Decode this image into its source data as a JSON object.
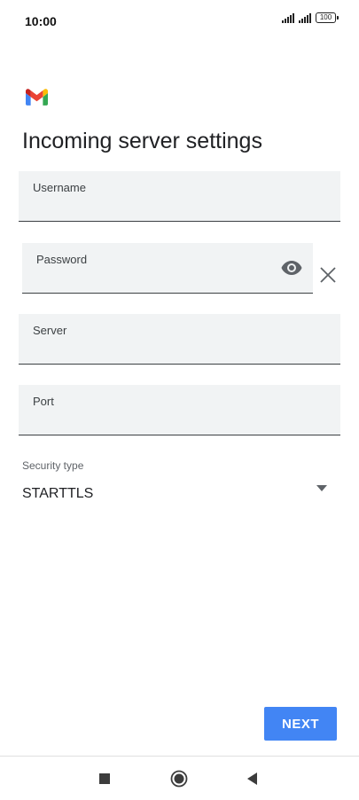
{
  "status_bar": {
    "time": "10:00",
    "battery": "100",
    "icons": [
      "signal-icon",
      "signal-icon",
      "battery-icon"
    ]
  },
  "header": {
    "logo": "gmail-logo",
    "title": "Incoming server settings"
  },
  "form": {
    "username": {
      "label": "Username",
      "value": ""
    },
    "password": {
      "label": "Password",
      "value": "",
      "toggle_icon": "eye-icon",
      "clear_icon": "close-icon"
    },
    "server": {
      "label": "Server",
      "value": ""
    },
    "port": {
      "label": "Port",
      "value": ""
    },
    "security": {
      "label": "Security type",
      "value": "STARTTLS",
      "icon": "dropdown-arrow-icon"
    }
  },
  "actions": {
    "next_label": "NEXT"
  },
  "navigation": {
    "buttons": [
      "recents-icon",
      "home-icon",
      "back-icon"
    ]
  },
  "colors": {
    "accent": "#4285f4",
    "field_background": "#f1f3f4"
  }
}
